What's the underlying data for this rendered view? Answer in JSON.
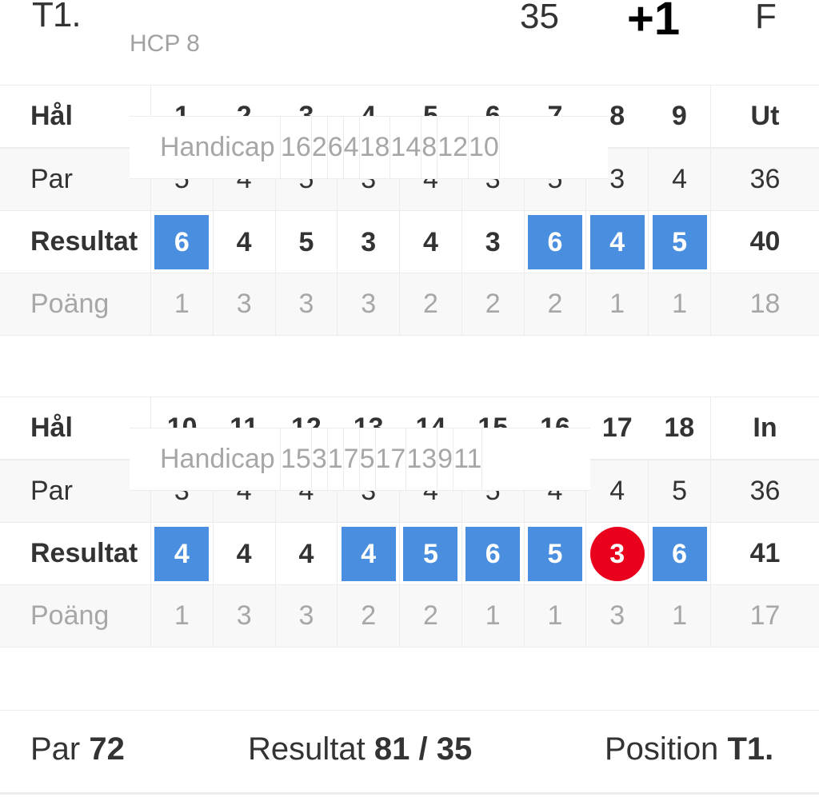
{
  "header": {
    "position": "T1.",
    "handicap": "HCP 8",
    "points": "35",
    "to_par": "+1",
    "status": "F"
  },
  "colors": {
    "over_par": "#4a8fdf",
    "under_par": "#e8001c"
  },
  "front_nine": {
    "hole_label": "Hål",
    "holes": [
      "1",
      "2",
      "3",
      "4",
      "5",
      "6",
      "7",
      "8",
      "9"
    ],
    "total_label": "Ut",
    "handicap_label": "Handicap",
    "handicap": [
      "16",
      "2",
      "6",
      "4",
      "18",
      "14",
      "8",
      "12",
      "10"
    ],
    "handicap_total": "",
    "par_label": "Par",
    "par": [
      "5",
      "4",
      "5",
      "3",
      "4",
      "3",
      "5",
      "3",
      "4"
    ],
    "par_total": "36",
    "result_label": "Resultat",
    "result": [
      "6",
      "4",
      "5",
      "3",
      "4",
      "3",
      "6",
      "4",
      "5"
    ],
    "result_style": [
      "over",
      "",
      "",
      "",
      "",
      "",
      "over",
      "over",
      "over"
    ],
    "result_total": "40",
    "points_label": "Poäng",
    "points": [
      "1",
      "3",
      "3",
      "3",
      "2",
      "2",
      "2",
      "1",
      "1"
    ],
    "points_total": "18"
  },
  "back_nine": {
    "hole_label": "Hål",
    "holes": [
      "10",
      "11",
      "12",
      "13",
      "14",
      "15",
      "16",
      "17",
      "18"
    ],
    "total_label": "In",
    "handicap_label": "Handicap",
    "handicap": [
      "15",
      "3",
      "1",
      "7",
      "5",
      "17",
      "13",
      "9",
      "11"
    ],
    "handicap_total": "",
    "par_label": "Par",
    "par": [
      "3",
      "4",
      "4",
      "3",
      "4",
      "5",
      "4",
      "4",
      "5"
    ],
    "par_total": "36",
    "result_label": "Resultat",
    "result": [
      "4",
      "4",
      "4",
      "4",
      "5",
      "6",
      "5",
      "3",
      "6"
    ],
    "result_style": [
      "over",
      "",
      "",
      "over",
      "over",
      "over",
      "over",
      "under",
      "over"
    ],
    "result_total": "41",
    "points_label": "Poäng",
    "points": [
      "1",
      "3",
      "3",
      "2",
      "2",
      "1",
      "1",
      "3",
      "1"
    ],
    "points_total": "17"
  },
  "footer": {
    "par_label": "Par",
    "par_value": "72",
    "result_label": "Resultat",
    "result_value": "81 / 35",
    "position_label": "Position",
    "position_value": "T1."
  }
}
